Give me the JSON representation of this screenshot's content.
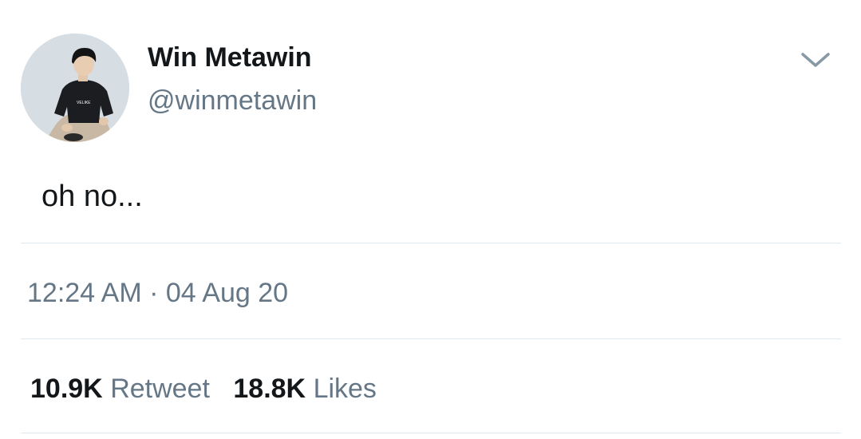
{
  "tweet": {
    "author": {
      "display_name": "Win Metawin",
      "handle": "@winmetawin",
      "avatar_icon": "profile-photo",
      "shirt_text": "VELIKE"
    },
    "menu_icon": "chevron-down-icon",
    "text": "oh no...",
    "timestamp": {
      "time": "12:24 AM",
      "separator": "·",
      "date": "04 Aug 20"
    },
    "stats": {
      "retweets": {
        "count": "10.9K",
        "label": "Retweet"
      },
      "likes": {
        "count": "18.8K",
        "label": "Likes"
      }
    }
  },
  "colors": {
    "primary_text": "#14171a",
    "secondary_text": "#657786",
    "divider": "#e1e8ed",
    "avatar_background": "#d9e0e6"
  }
}
